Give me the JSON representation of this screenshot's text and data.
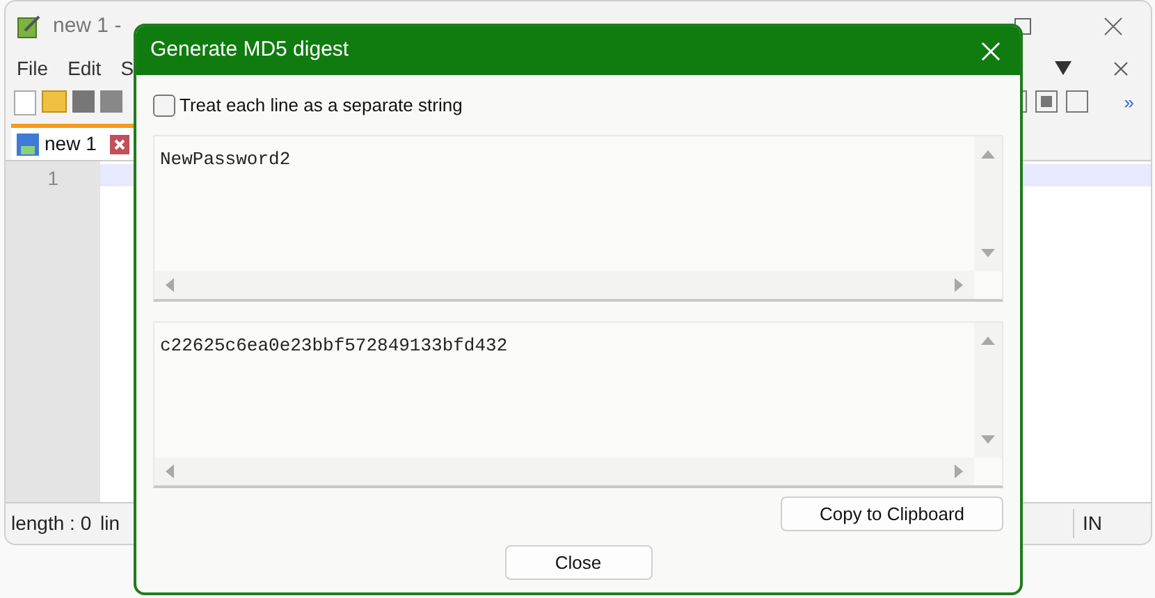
{
  "app_window": {
    "title": "new 1 -",
    "toolbar_overflow": "»",
    "menu": [
      "File",
      "Edit",
      "S"
    ],
    "tab": {
      "label": "new 1",
      "selected": true
    },
    "line_numbers": [
      "1"
    ],
    "status_bar": [
      "length : 0",
      "lin",
      "IN"
    ]
  },
  "dialog": {
    "title": "Generate MD5 digest",
    "checkbox": {
      "label": "Treat each line as a separate string",
      "checked": false
    },
    "input_text": "NewPassword2",
    "output_text": "c22625c6ea0e23bbf572849133bfd432",
    "buttons": [
      "Copy to Clipboard",
      "Close"
    ]
  }
}
